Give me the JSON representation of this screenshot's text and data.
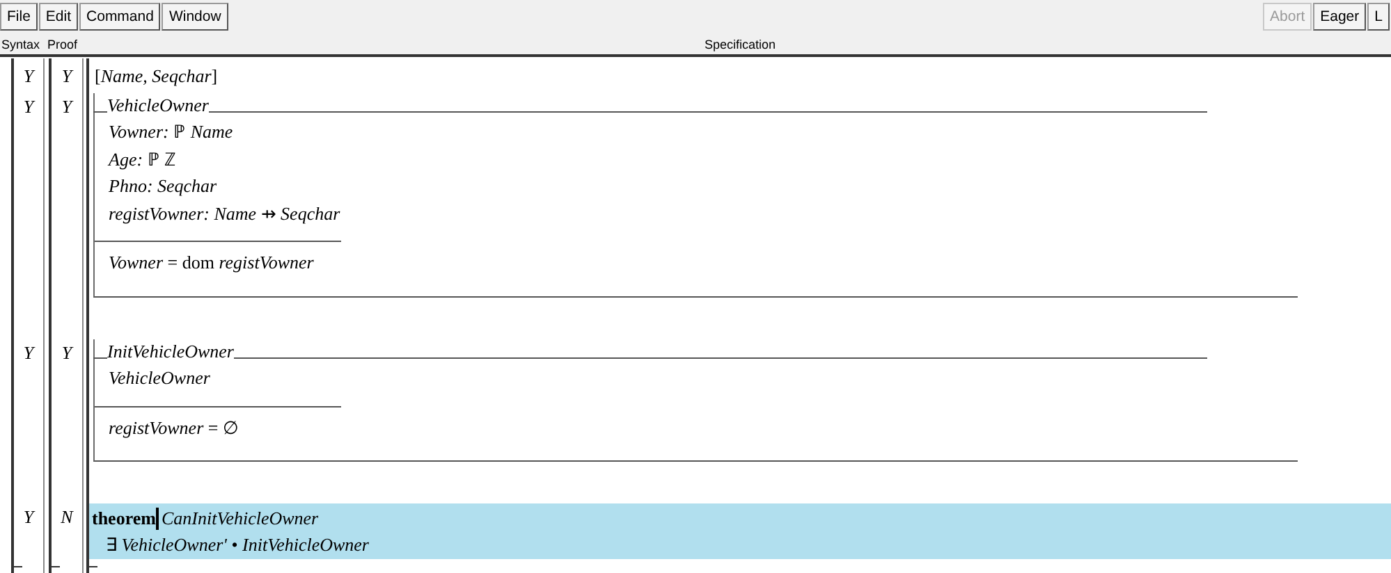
{
  "toolbar": {
    "left_buttons": [
      {
        "label": "File"
      },
      {
        "label": "Edit"
      },
      {
        "label": "Command"
      },
      {
        "label": "Window"
      }
    ],
    "right_buttons": [
      {
        "label": "Abort",
        "disabled": true
      },
      {
        "label": "Eager",
        "disabled": false
      },
      {
        "label": "L",
        "disabled": false
      }
    ]
  },
  "columns": [
    "Syntax",
    "Proof",
    "Specification"
  ],
  "paragraphs": [
    {
      "kind": "given",
      "syntax": "Y",
      "proof": "Y",
      "selected": false,
      "text": "[*Name, Seqchar*]"
    },
    {
      "kind": "schema",
      "syntax": "Y",
      "proof": "Y",
      "selected": false,
      "name": "VehicleOwner",
      "declarations": [
        "*Vowner:* ℙ *Name*",
        "*Age:* ℙ ℤ",
        "*Phno: Seqchar*",
        "*registVowner: Name* ⇸ *Seqchar*"
      ],
      "predicates": [
        "*Vowner* = dom *registVowner*"
      ]
    },
    {
      "kind": "schema",
      "syntax": "Y",
      "proof": "Y",
      "selected": false,
      "name": "InitVehicleOwner",
      "declarations": [
        "*VehicleOwner*"
      ],
      "predicates": [
        "*registVowner* = ∅"
      ]
    },
    {
      "kind": "theorem",
      "syntax": "Y",
      "proof": "N",
      "selected": true,
      "keyword": "theorem",
      "name": "CanInitVehicleOwner",
      "body": "∃ *VehicleOwner'* • *InitVehicleOwner*"
    }
  ]
}
